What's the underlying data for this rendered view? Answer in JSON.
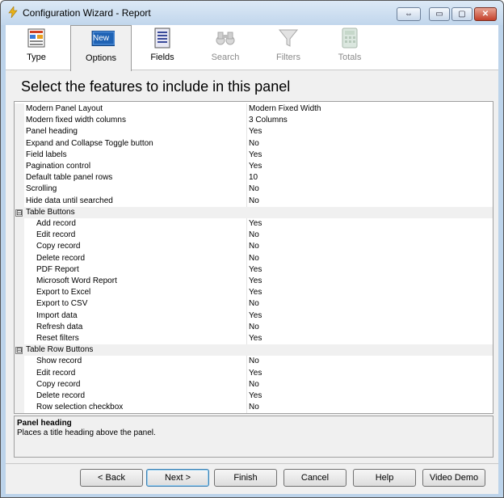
{
  "window": {
    "title": "Configuration Wizard - Report",
    "buttons": {
      "restore_label": "⇔",
      "minimize_label": "▭",
      "maximize_label": "▢",
      "close_label": "✕"
    }
  },
  "toolbar": {
    "items": [
      {
        "label": "Type",
        "icon": "type-icon",
        "state": "enabled"
      },
      {
        "label": "Options",
        "icon": "options-new-icon",
        "state": "active",
        "badge": "New"
      },
      {
        "label": "Fields",
        "icon": "fields-icon",
        "state": "enabled"
      },
      {
        "label": "Search",
        "icon": "binoculars-icon",
        "state": "disabled"
      },
      {
        "label": "Filters",
        "icon": "funnel-icon",
        "state": "disabled"
      },
      {
        "label": "Totals",
        "icon": "calculator-icon",
        "state": "disabled"
      }
    ]
  },
  "heading": "Select the features to include in this panel",
  "properties": [
    {
      "name": "Modern Panel Layout",
      "value": "Modern Fixed Width",
      "kind": "top"
    },
    {
      "name": "Modern fixed width columns",
      "value": "3 Columns",
      "kind": "top"
    },
    {
      "name": "Panel heading",
      "value": "Yes",
      "kind": "top"
    },
    {
      "name": "Expand and Collapse Toggle button",
      "value": "No",
      "kind": "top"
    },
    {
      "name": "Field labels",
      "value": "Yes",
      "kind": "top"
    },
    {
      "name": "Pagination control",
      "value": "Yes",
      "kind": "top"
    },
    {
      "name": "Default table panel rows",
      "value": "10",
      "kind": "top"
    },
    {
      "name": "Scrolling",
      "value": "No",
      "kind": "top"
    },
    {
      "name": "Hide data until searched",
      "value": "No",
      "kind": "top"
    },
    {
      "name": "Table Buttons",
      "value": "",
      "kind": "cat",
      "toggle": "⊟"
    },
    {
      "name": "Add record",
      "value": "Yes",
      "kind": "child"
    },
    {
      "name": "Edit record",
      "value": "No",
      "kind": "child"
    },
    {
      "name": "Copy record",
      "value": "No",
      "kind": "child"
    },
    {
      "name": "Delete record",
      "value": "No",
      "kind": "child"
    },
    {
      "name": "PDF Report",
      "value": "Yes",
      "kind": "child"
    },
    {
      "name": "Microsoft Word Report",
      "value": "Yes",
      "kind": "child"
    },
    {
      "name": "Export to Excel",
      "value": "Yes",
      "kind": "child"
    },
    {
      "name": "Export to CSV",
      "value": "No",
      "kind": "child"
    },
    {
      "name": "Import data",
      "value": "Yes",
      "kind": "child"
    },
    {
      "name": "Refresh data",
      "value": "No",
      "kind": "child"
    },
    {
      "name": "Reset filters",
      "value": "Yes",
      "kind": "child"
    },
    {
      "name": "Table Row Buttons",
      "value": "",
      "kind": "cat",
      "toggle": "⊟"
    },
    {
      "name": "Show record",
      "value": "No",
      "kind": "child"
    },
    {
      "name": "Edit record",
      "value": "Yes",
      "kind": "child"
    },
    {
      "name": "Copy record",
      "value": "No",
      "kind": "child"
    },
    {
      "name": "Delete record",
      "value": "Yes",
      "kind": "child"
    },
    {
      "name": "Row selection checkbox",
      "value": "No",
      "kind": "child"
    }
  ],
  "help": {
    "title": "Panel heading",
    "description": "Places a title heading above the panel."
  },
  "footer": {
    "back_label": "< Back",
    "next_label": "Next >",
    "finish_label": "Finish",
    "cancel_label": "Cancel",
    "help_label": "Help",
    "video_label": "Video Demo"
  },
  "colors": {
    "titlebar": "#c1d6ec",
    "close_button": "#c4402a",
    "options_badge": "#1f63b5"
  }
}
